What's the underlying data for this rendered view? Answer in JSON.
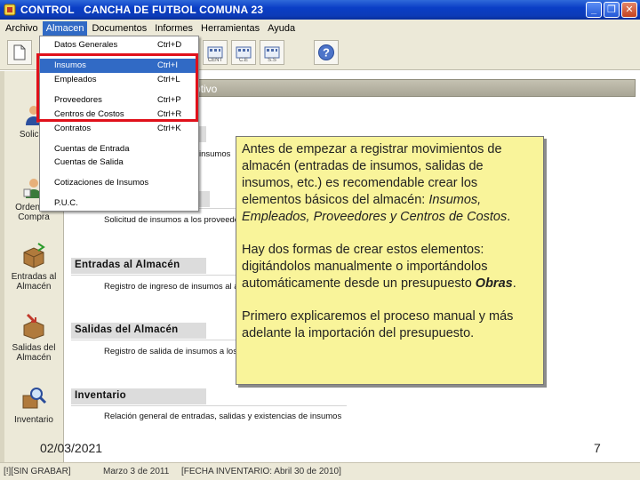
{
  "window": {
    "title": "CONTROL   CANCHA DE FUTBOL COMUNA 23"
  },
  "menubar": [
    "Archivo",
    "Almacen",
    "Documentos",
    "Informes",
    "Herramientas",
    "Ayuda"
  ],
  "toolbar": {
    "buttons": [
      "CENT",
      "C.E",
      "S.S"
    ]
  },
  "dropdown": {
    "items": [
      {
        "label": "Datos Generales",
        "shortcut": "Ctrl+D"
      },
      {
        "label": "Insumos",
        "shortcut": "Ctrl+I"
      },
      {
        "label": "Empleados",
        "shortcut": "Ctrl+L"
      },
      {
        "label": "Proveedores",
        "shortcut": "Ctrl+P"
      },
      {
        "label": "Centros de Costos",
        "shortcut": "Ctrl+R"
      },
      {
        "label": "Contratos",
        "shortcut": "Ctrl+K"
      },
      {
        "label": "Cuentas de Entrada",
        "shortcut": ""
      },
      {
        "label": "Cuentas de Salida",
        "shortcut": ""
      },
      {
        "label": "Cotizaciones de Insumos",
        "shortcut": ""
      },
      {
        "label": "P.U.C.",
        "shortcut": ""
      }
    ]
  },
  "sidebar": {
    "items": [
      {
        "label": "Solicitu"
      },
      {
        "label": "Orden de Compra"
      },
      {
        "label": "Entradas al Almacén"
      },
      {
        "label": "Salidas del Almacén"
      },
      {
        "label": "Inventario"
      }
    ]
  },
  "content": {
    "header_fragment": "ptivo",
    "sections": [
      {
        "title": "",
        "desc": "insumos"
      },
      {
        "title": "",
        "desc": "Solicitud de insumos a los proveedores"
      },
      {
        "title": "Entradas al Almacén",
        "desc": "Registro de ingreso de insumos al almacén"
      },
      {
        "title": "Salidas del Almacén",
        "desc": "Registro de salida de insumos a los frentes"
      },
      {
        "title": "Inventario",
        "desc": "Relación general de entradas, salidas y existencias de insumos"
      }
    ]
  },
  "note": {
    "p1_a": "Antes de empezar a registrar movimientos de almacén (entradas de insumos, salidas de insumos, etc.) es recomendable crear los elementos básicos del almacén: ",
    "p1_b": "Insumos, Empleados, Proveedores",
    "p1_c": " y ",
    "p1_d": "Centros de Costos",
    "p1_e": ".",
    "p2_a": "Hay dos formas de crear estos elementos: digitándolos manualmente o importándolos automáticamente desde un presupuesto ",
    "p2_b": "Obras",
    "p2_c": ".",
    "p3": "Primero explicaremos el proceso manual y más adelante la importación del presupuesto."
  },
  "footer": {
    "date": "02/03/2021",
    "slide_number": "7"
  },
  "statusbar": [
    "[!][SIN GRABAR]",
    "Marzo 3 de 2011",
    "[FECHA INVENTARIO: Abril 30 de 2010]"
  ]
}
